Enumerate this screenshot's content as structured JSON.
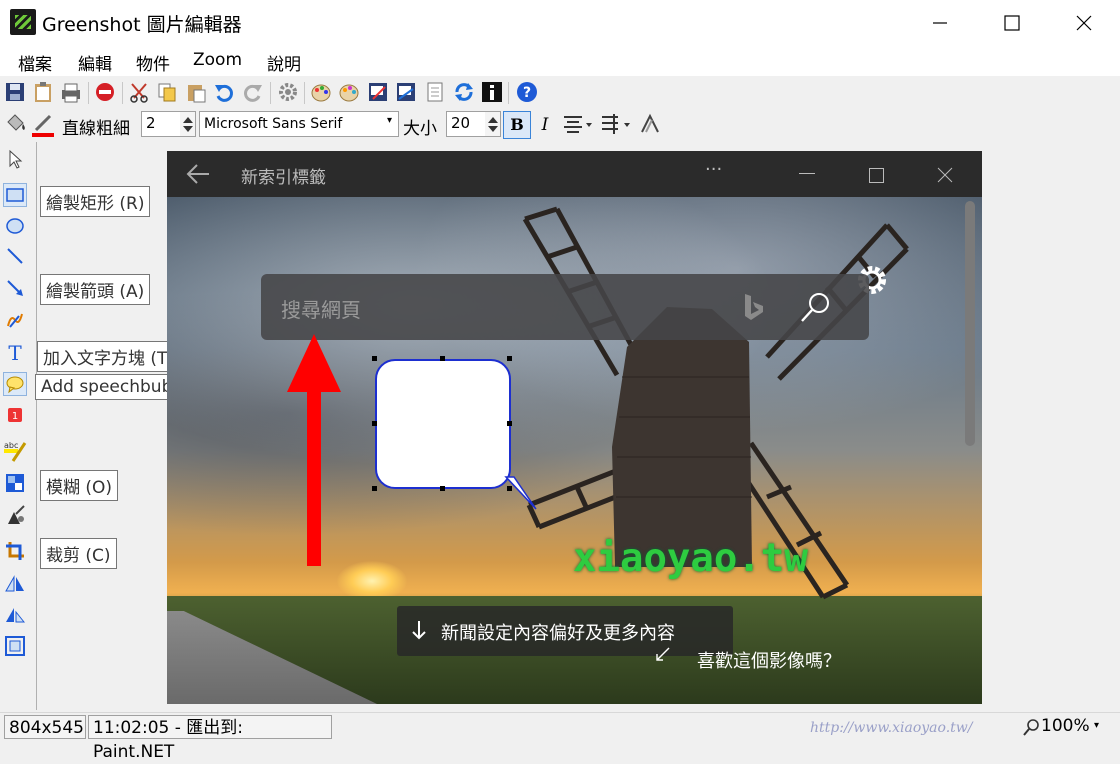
{
  "window": {
    "title": "Greenshot 圖片編輯器"
  },
  "menu": {
    "items": [
      "檔案",
      "編輯",
      "物件",
      "Zoom",
      "說明"
    ]
  },
  "toolbar2": {
    "line_width_label": "直線粗細",
    "line_width_value": "2",
    "font_value": "Microsoft Sans Serif",
    "size_label": "大小",
    "size_value": "20",
    "bold_label": "B",
    "italic_label": "I"
  },
  "tool_tooltips": {
    "rect": "繪製矩形 (R)",
    "arrow": "繪製箭頭 (A)",
    "text": "加入文字方塊 (T)",
    "speechbubble": "Add speechbubble (S)",
    "blur": "模糊 (O)",
    "crop": "裁剪 (C)"
  },
  "canvas": {
    "browser_title": "新索引標籤",
    "menu_dots": "···",
    "search_placeholder": "搜尋網頁",
    "watermark": "xiaoyao.tw",
    "news_text": "新聞設定內容偏好及更多內容",
    "like_text": "喜歡這個影像嗎？"
  },
  "status": {
    "dimensions": "804x545",
    "export_info": "11:02:05 - 匯出到: Paint.NET",
    "zoom": "100%",
    "site_watermark": "http://www.xiaoyao.tw/"
  },
  "colors": {
    "arrow_red": "#ff0000",
    "bubble_border": "#1d2fd0",
    "watermark_green": "#2ecc40",
    "accent_blue": "#1e6fd9"
  }
}
